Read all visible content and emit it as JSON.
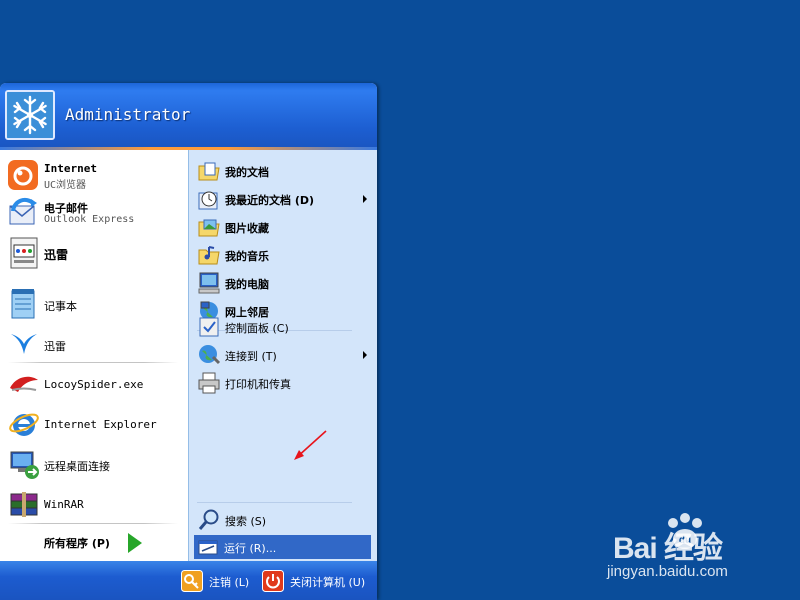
{
  "user": {
    "name": "Administrator"
  },
  "pinned": [
    {
      "title": "Internet",
      "subtitle": "UC浏览器",
      "icon": "uc-browser-icon"
    },
    {
      "title": "电子邮件",
      "subtitle": "Outlook Express",
      "icon": "outlook-express-icon"
    },
    {
      "title": "迅雷",
      "subtitle": "",
      "icon": "xunlei-app-icon"
    }
  ],
  "recent_programs": [
    {
      "label": "记事本",
      "icon": "notepad-icon"
    },
    {
      "label": "迅雷",
      "icon": "xunlei-bird-icon"
    },
    {
      "label": "LocoySpider.exe",
      "icon": "locoyspider-icon"
    },
    {
      "label": "Internet Explorer",
      "icon": "internet-explorer-icon"
    },
    {
      "label": "远程桌面连接",
      "icon": "remote-desktop-icon"
    },
    {
      "label": "WinRAR",
      "icon": "winrar-icon"
    }
  ],
  "all_programs": {
    "label": "所有程序 (P)"
  },
  "places": [
    {
      "label": "我的文档",
      "icon": "my-documents-icon",
      "submenu": false
    },
    {
      "label": "我最近的文档 (D)",
      "icon": "recent-documents-icon",
      "submenu": true
    },
    {
      "label": "图片收藏",
      "icon": "my-pictures-icon",
      "submenu": false
    },
    {
      "label": "我的音乐",
      "icon": "my-music-icon",
      "submenu": false
    },
    {
      "label": "我的电脑",
      "icon": "my-computer-icon",
      "submenu": false
    },
    {
      "label": "网上邻居",
      "icon": "network-places-icon",
      "submenu": false
    }
  ],
  "system": [
    {
      "label": "控制面板 (C)",
      "icon": "control-panel-icon",
      "submenu": false
    },
    {
      "label": "连接到 (T)",
      "icon": "connect-to-icon",
      "submenu": true
    },
    {
      "label": "打印机和传真",
      "icon": "printers-faxes-icon",
      "submenu": false
    }
  ],
  "tools": [
    {
      "label": "搜索 (S)",
      "icon": "search-icon"
    },
    {
      "label": "运行 (R)...",
      "icon": "run-icon",
      "highlighted": true
    }
  ],
  "footer": {
    "logoff_label": "注销 (L)",
    "shutdown_label": "关闭计算机 (U)"
  },
  "watermark": {
    "brand": "Bai 经验",
    "url": "jingyan.baidu.com"
  },
  "colors": {
    "desktop": "#0a4d9a",
    "header_blue": "#1d5fd2",
    "right_pane": "#d3e5fa",
    "highlight": "#3168c7",
    "annotation_red": "#e8141b"
  }
}
